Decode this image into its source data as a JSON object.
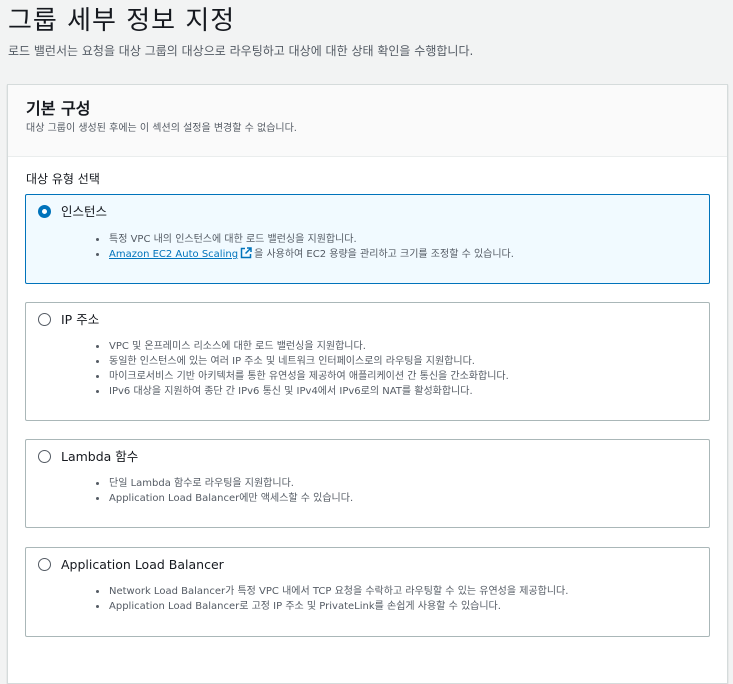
{
  "header": {
    "title": "그룹 세부 정보 지정",
    "description": "로드 밸런서는 요청을 대상 그룹의 대상으로 라우팅하고 대상에 대한 상태 확인을 수행합니다."
  },
  "basic_config": {
    "title": "기본 구성",
    "subtitle": "대상 그룹이 생성된 후에는 이 섹션의 설정을 변경할 수 없습니다.",
    "target_type_label": "대상 유형 선택"
  },
  "options": {
    "instances": {
      "label": "인스턴스",
      "selected": true,
      "bullets": [
        "특정 VPC 내의 인스턴스에 대한 로드 밸런싱을 지원합니다.",
        "을 사용하여 EC2 용량을 관리하고 크기를 조정할 수 있습니다."
      ],
      "link_text": "Amazon EC2 Auto Scaling"
    },
    "ip": {
      "label": "IP 주소",
      "selected": false,
      "bullets": [
        "VPC 및 온프레미스 리소스에 대한 로드 밸런싱을 지원합니다.",
        "동일한 인스턴스에 있는 여러 IP 주소 및 네트워크 인터페이스로의 라우팅을 지원합니다.",
        "마이크로서비스 기반 아키텍처를 통한 유연성을 제공하여 애플리케이션 간 통신을 간소화합니다.",
        "IPv6 대상을 지원하여 종단 간 IPv6 통신 및 IPv4에서 IPv6로의 NAT를 활성화합니다."
      ]
    },
    "lambda": {
      "label": "Lambda 함수",
      "selected": false,
      "bullets": [
        "단일 Lambda 함수로 라우팅을 지원합니다.",
        "Application Load Balancer에만 액세스할 수 있습니다."
      ]
    },
    "alb": {
      "label": "Application Load Balancer",
      "selected": false,
      "bullets": [
        "Network Load Balancer가 특정 VPC 내에서 TCP 요청을 수락하고 라우팅할 수 있는 유연성을 제공합니다.",
        "Application Load Balancer로 고정 IP 주소 및 PrivateLink를 손쉽게 사용할 수 있습니다."
      ]
    }
  },
  "icons": {
    "external_link": "external-link-icon"
  },
  "colors": {
    "accent": "#0073bb",
    "selected_bg": "#f1faff",
    "border": "#aab7b8"
  }
}
